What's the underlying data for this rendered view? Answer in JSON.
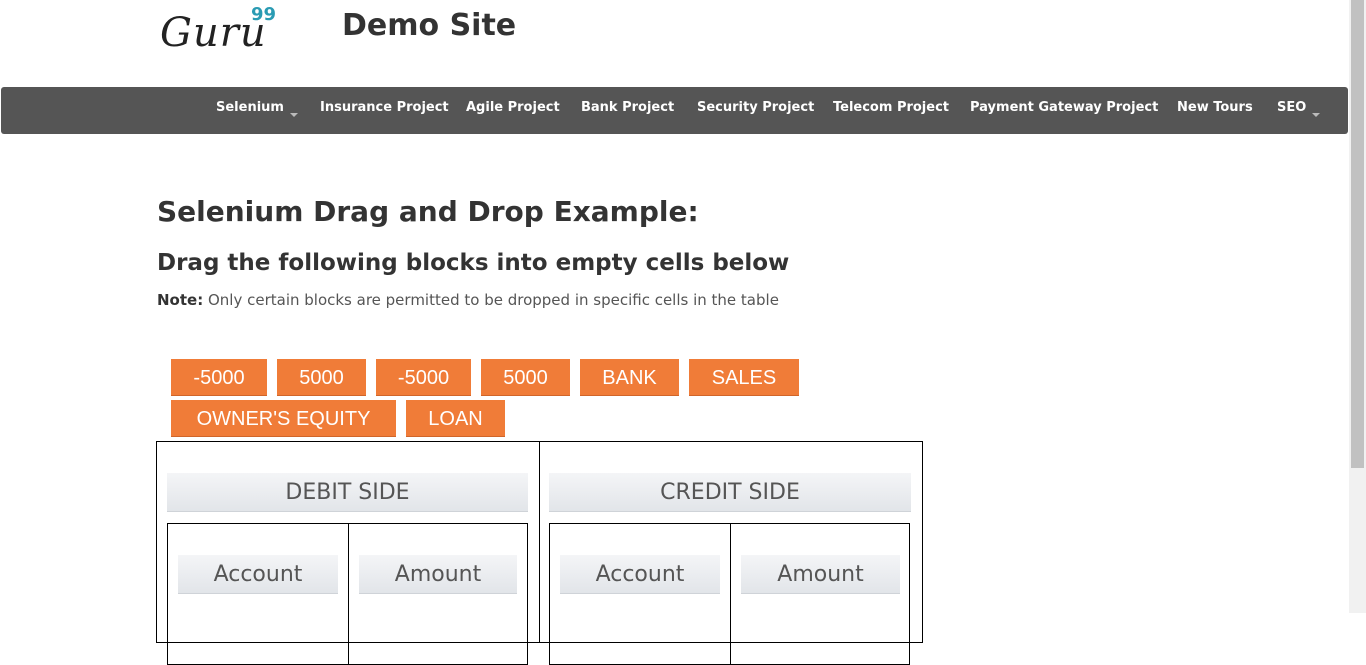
{
  "header": {
    "logo_text": "Guru",
    "logo_sup": "99",
    "site_title": "Demo Site"
  },
  "nav": {
    "items": [
      {
        "label": "Selenium",
        "dropdown": true
      },
      {
        "label": "Insurance Project",
        "dropdown": false
      },
      {
        "label": "Agile Project",
        "dropdown": false
      },
      {
        "label": "Bank Project",
        "dropdown": false
      },
      {
        "label": "Security Project",
        "dropdown": false
      },
      {
        "label": "Telecom Project",
        "dropdown": false
      },
      {
        "label": "Payment Gateway Project",
        "dropdown": false
      },
      {
        "label": "New Tours",
        "dropdown": false
      },
      {
        "label": "SEO",
        "dropdown": true
      }
    ]
  },
  "content": {
    "heading": "Selenium Drag and Drop Example:",
    "subheading": "Drag the following blocks into empty cells below",
    "note_label": "Note:",
    "note_text": " Only certain blocks are permitted to be dropped in specific cells in the table"
  },
  "blocks": [
    "-5000",
    "5000",
    "-5000",
    "5000",
    "BANK",
    "SALES",
    "OWNER'S EQUITY",
    "LOAN"
  ],
  "table": {
    "debit_header": "DEBIT SIDE",
    "credit_header": "CREDIT SIDE",
    "debit_columns": [
      "Account",
      "Amount"
    ],
    "credit_columns": [
      "Account",
      "Amount"
    ]
  },
  "colors": {
    "block_bg": "#f07c38",
    "navbar_bg": "#555555",
    "logo_accent": "#2a9bb3"
  }
}
